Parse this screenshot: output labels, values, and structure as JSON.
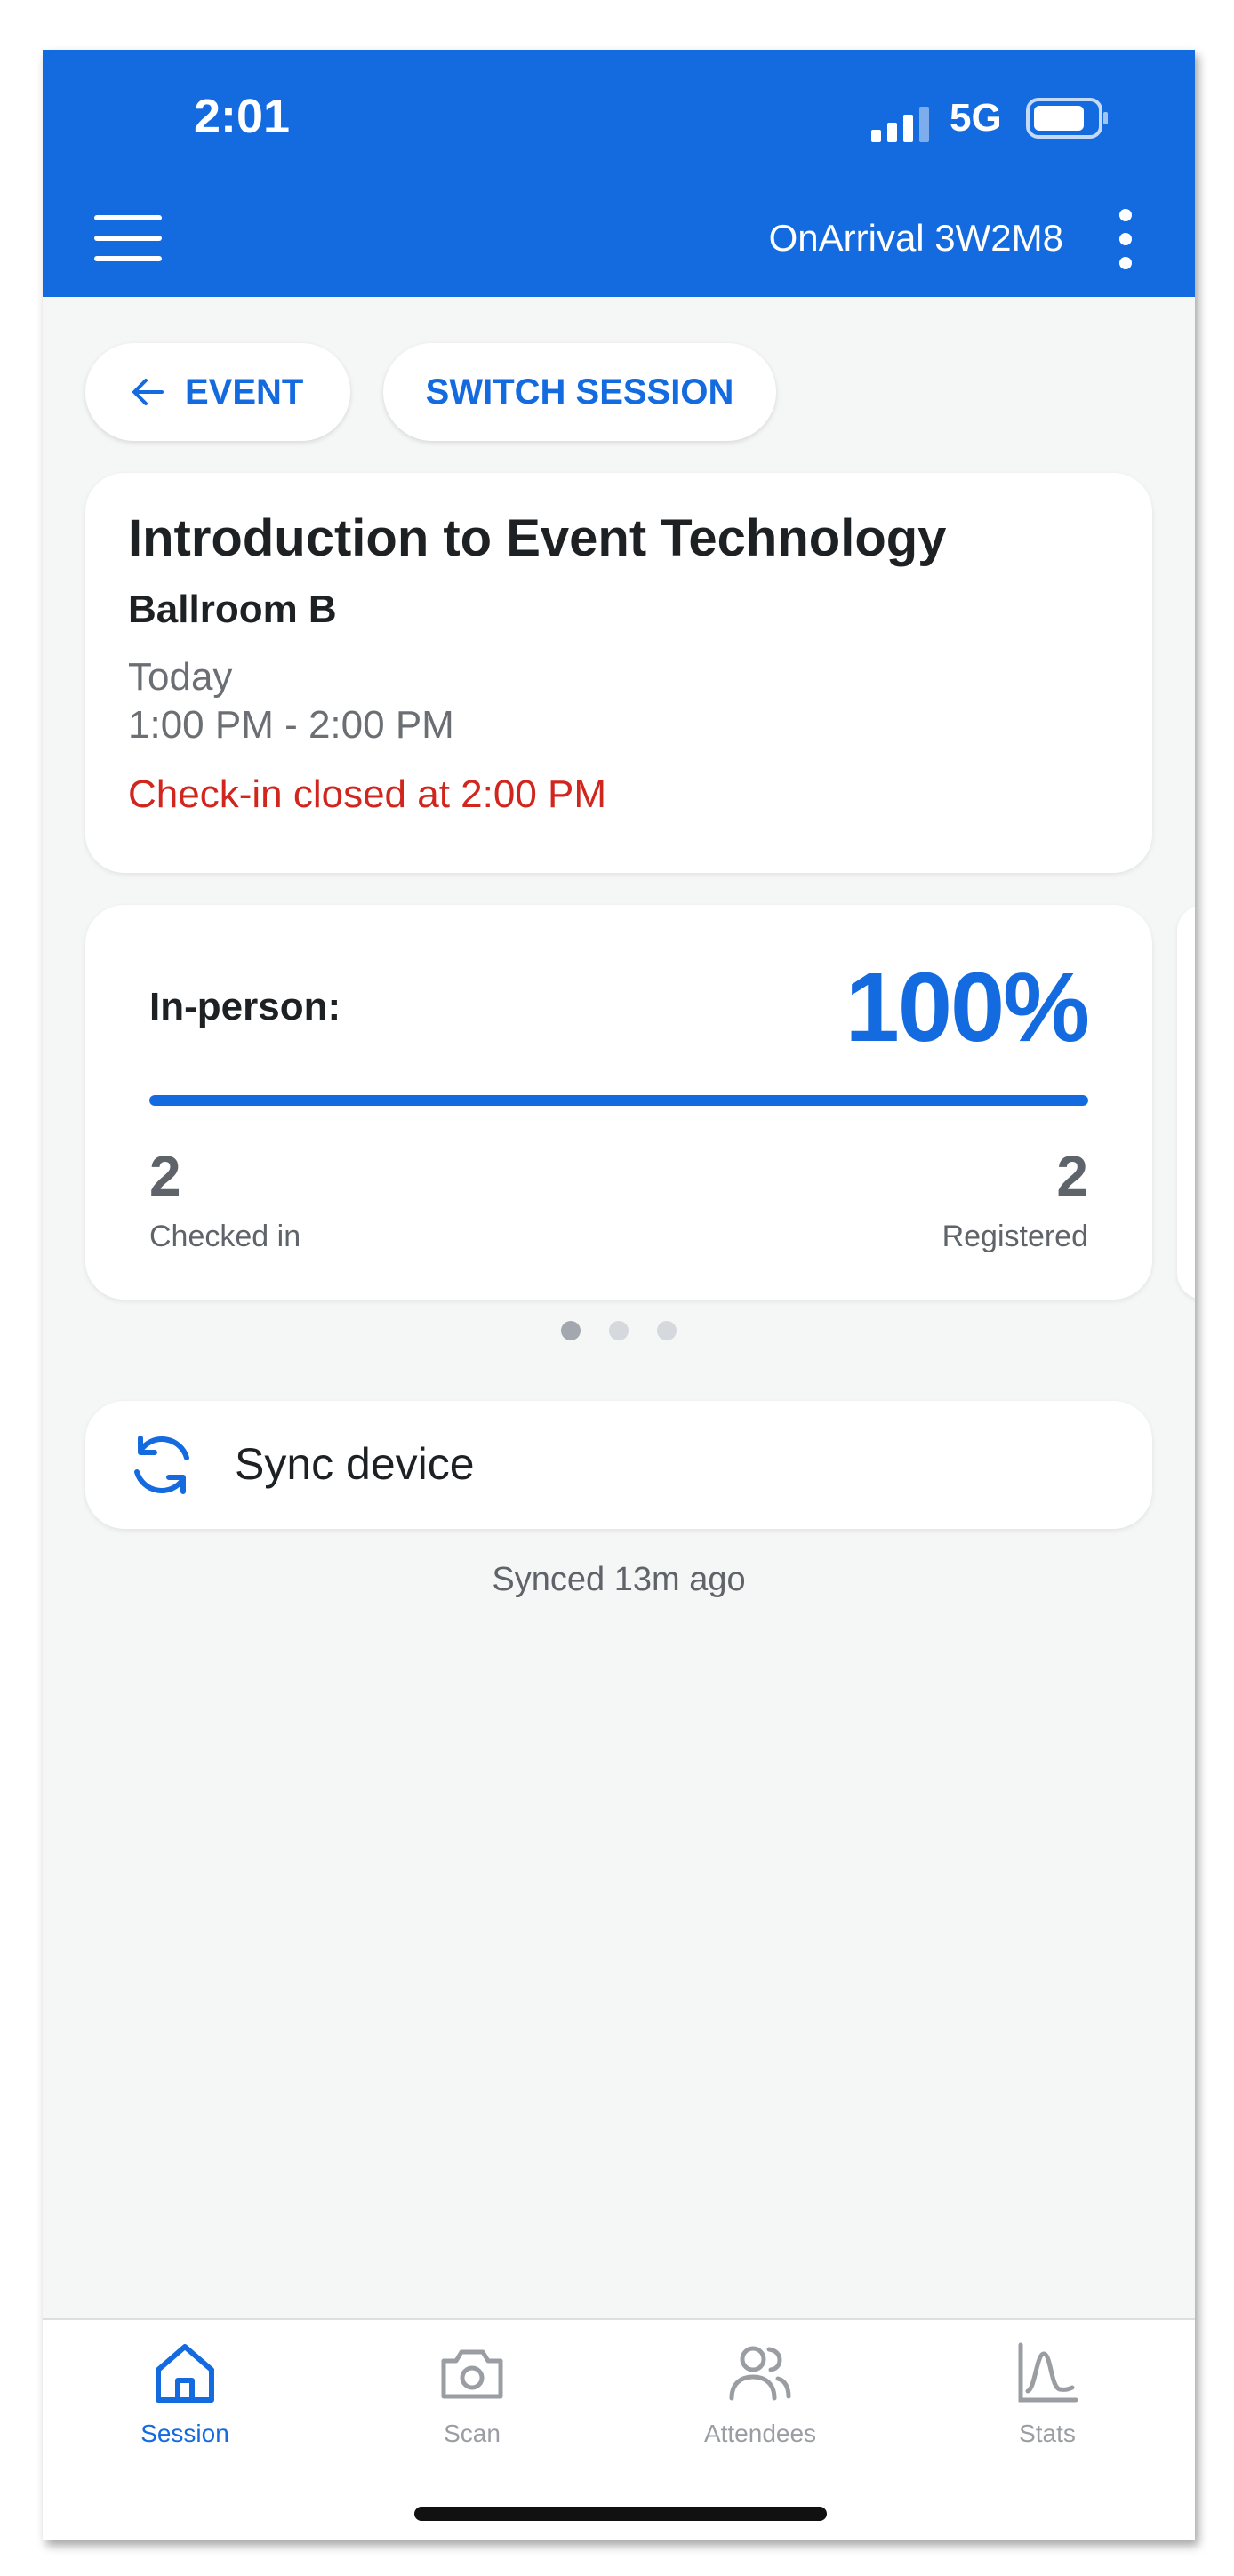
{
  "status_bar": {
    "time": "2:01",
    "network": "5G",
    "signal_icon": "cell-signal-icon",
    "battery_icon": "battery-icon"
  },
  "app_bar": {
    "title": "OnArrival 3W2M8",
    "menu_icon": "hamburger-menu-icon",
    "more_icon": "more-vertical-icon"
  },
  "nav_chips": {
    "back_label": "EVENT",
    "back_icon": "arrow-left-icon",
    "switch_label": "SWITCH SESSION"
  },
  "session": {
    "title": "Introduction to Event Technology",
    "room": "Ballroom B",
    "day": "Today",
    "time_range": "1:00 PM - 2:00 PM",
    "checkin_status": "Check-in closed at 2:00 PM"
  },
  "stats": {
    "label": "In-person:",
    "percent": "100%",
    "progress": 1.0,
    "checked_in_value": "2",
    "checked_in_label": "Checked in",
    "registered_value": "2",
    "registered_label": "Registered"
  },
  "pager": {
    "count": 3,
    "active": 0
  },
  "sync": {
    "label": "Sync device",
    "icon": "sync-icon",
    "status": "Synced 13m ago"
  },
  "tabs": [
    {
      "label": "Session",
      "icon": "home-icon",
      "active": true
    },
    {
      "label": "Scan",
      "icon": "camera-icon",
      "active": false
    },
    {
      "label": "Attendees",
      "icon": "users-icon",
      "active": false
    },
    {
      "label": "Stats",
      "icon": "chart-icon",
      "active": false
    }
  ],
  "colors": {
    "primary": "#146be0",
    "alert": "#d0261e",
    "background": "#f5f6f6"
  }
}
